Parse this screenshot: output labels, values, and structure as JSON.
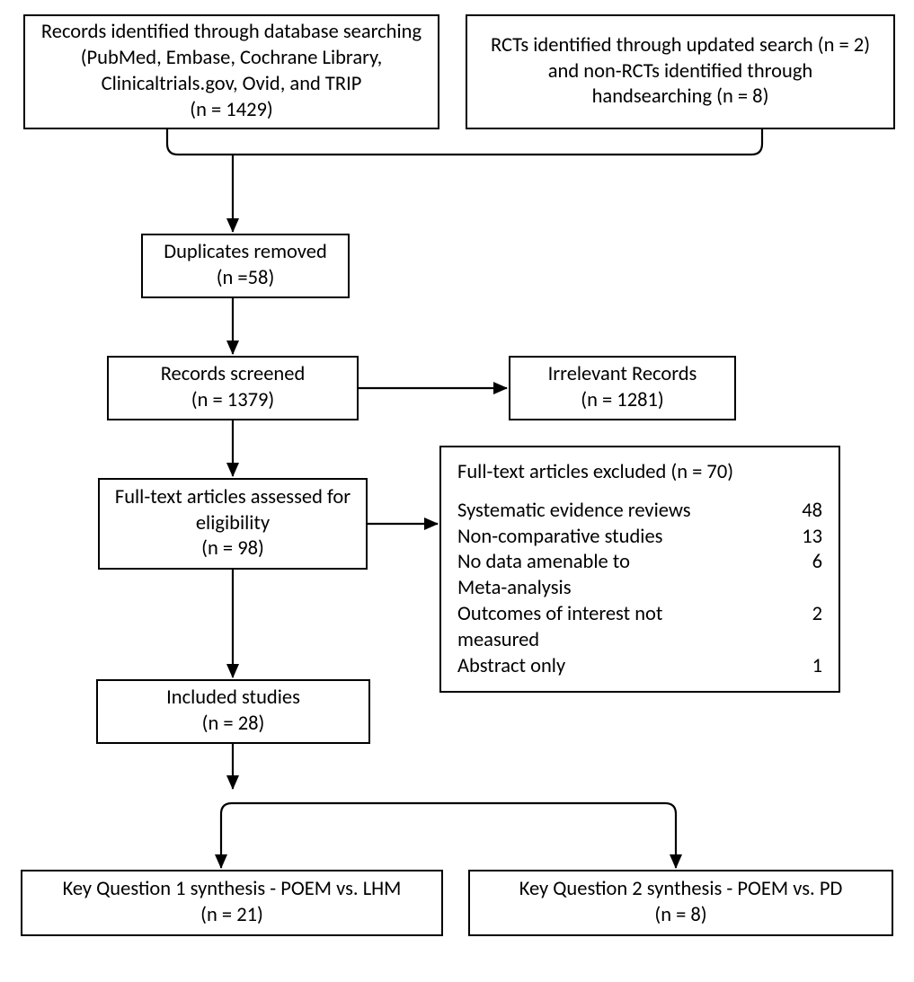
{
  "chart_data": {
    "type": "flow-diagram",
    "nodes": [
      {
        "id": "dbSearch",
        "lines": [
          "Records identified through database searching",
          "(PubMed, Embase, Cochrane Library,",
          "Clinicaltrials.gov, Ovid, and TRIP",
          "(n = 1429)"
        ]
      },
      {
        "id": "otherSearch",
        "lines": [
          "RCTs identified through updated search (n = 2)",
          "and non-RCTs identified through",
          "handsearching (n = 8)"
        ]
      },
      {
        "id": "dupRemoved",
        "lines": [
          "Duplicates removed",
          "(n =58)"
        ]
      },
      {
        "id": "screened",
        "lines": [
          "Records screened",
          "(n = 1379)"
        ]
      },
      {
        "id": "irrelevant",
        "lines": [
          "Irrelevant Records",
          "(n = 1281)"
        ]
      },
      {
        "id": "fulltext",
        "lines": [
          "Full-text articles assessed for",
          "eligibility",
          "(n = 98)"
        ]
      },
      {
        "id": "excluded",
        "title": "Full-text articles excluded (n = 70)",
        "reasons": [
          {
            "label": "Systematic evidence reviews",
            "count": 48
          },
          {
            "label": "Non-comparative studies",
            "count": 13
          },
          {
            "label": "No data amenable to Meta-analysis",
            "count": 6
          },
          {
            "label": "Outcomes of interest not measured",
            "count": 2
          },
          {
            "label": "Abstract only",
            "count": 1
          }
        ]
      },
      {
        "id": "included",
        "lines": [
          "Included studies",
          "(n = 28)"
        ]
      },
      {
        "id": "kq1",
        "lines": [
          "Key Question 1 synthesis - POEM vs. LHM",
          "(n = 21)"
        ]
      },
      {
        "id": "kq2",
        "lines": [
          "Key Question 2 synthesis - POEM vs. PD",
          "(n = 8)"
        ]
      }
    ],
    "edges": [
      [
        "dbSearch",
        "dupRemoved"
      ],
      [
        "otherSearch",
        "dupRemoved"
      ],
      [
        "dupRemoved",
        "screened"
      ],
      [
        "screened",
        "irrelevant"
      ],
      [
        "screened",
        "fulltext"
      ],
      [
        "fulltext",
        "excluded"
      ],
      [
        "fulltext",
        "included"
      ],
      [
        "included",
        "kq1"
      ],
      [
        "included",
        "kq2"
      ]
    ]
  },
  "boxes": {
    "dbSearch": {
      "l1": "Records identified through database searching",
      "l2": "(PubMed, Embase, Cochrane Library,",
      "l3": "Clinicaltrials.gov, Ovid, and TRIP",
      "l4": "(n = 1429)"
    },
    "otherSearch": {
      "l1": "RCTs identified through updated search (n = 2)",
      "l2": "and non-RCTs identified through",
      "l3": "handsearching (n = 8)"
    },
    "dupRemoved": {
      "l1": "Duplicates removed",
      "l2": "(n =58)"
    },
    "screened": {
      "l1": "Records screened",
      "l2": "(n = 1379)"
    },
    "irrelevant": {
      "l1": "Irrelevant Records",
      "l2": "(n = 1281)"
    },
    "fulltext": {
      "l1": "Full-text articles assessed for",
      "l2": "eligibility",
      "l3": "(n = 98)"
    },
    "excluded": {
      "title": "Full-text articles excluded (n = 70)",
      "r1l": "Systematic evidence reviews",
      "r1c": "48",
      "r2l": "Non-comparative studies",
      "r2c": "13",
      "r3l": "No data amenable to",
      "r3c": "6",
      "r3l2": "Meta-analysis",
      "r4l": "Outcomes of interest not",
      "r4c": "2",
      "r4l2": "measured",
      "r5l": "Abstract only",
      "r5c": "1"
    },
    "included": {
      "l1": "Included studies",
      "l2": "(n = 28)"
    },
    "kq1": {
      "l1": "Key Question 1 synthesis - POEM vs. LHM",
      "l2": "(n = 21)"
    },
    "kq2": {
      "l1": "Key Question 2 synthesis - POEM vs. PD",
      "l2": "(n = 8)"
    }
  }
}
